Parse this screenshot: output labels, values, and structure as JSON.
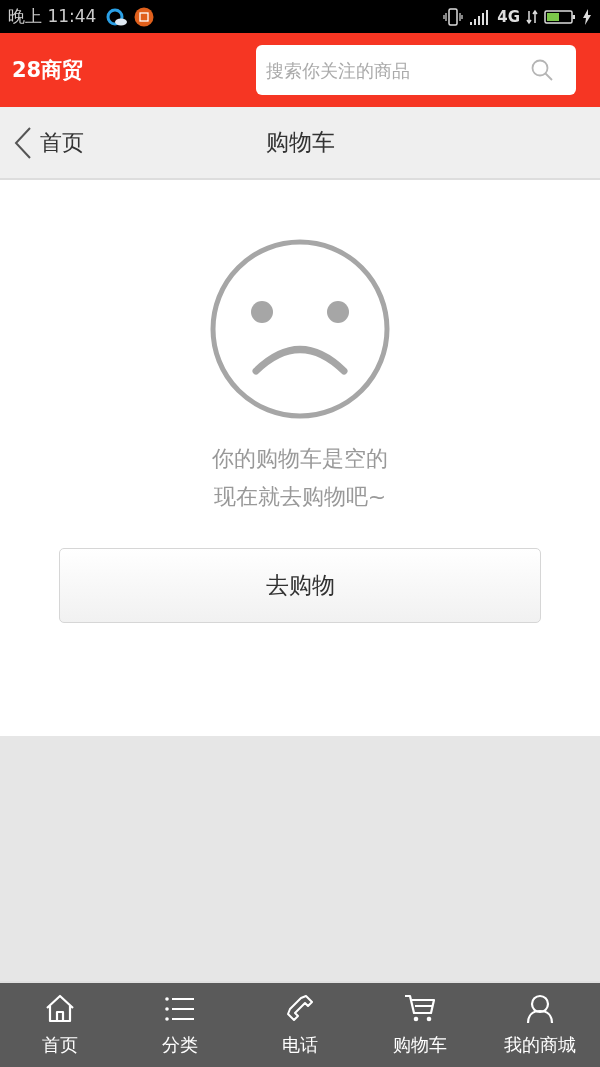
{
  "status_bar": {
    "time": "晚上 11:44",
    "network": "4G"
  },
  "header": {
    "logo": "28商贸",
    "search": {
      "placeholder": "搜索你关注的商品"
    }
  },
  "nav_bar": {
    "back_label": "首页",
    "title": "购物车"
  },
  "empty_cart": {
    "lines": [
      "你的购物车是空的",
      "现在就去购物吧~"
    ],
    "button": "去购物"
  },
  "tab_bar": [
    {
      "kind": "home",
      "label": "首页"
    },
    {
      "kind": "list",
      "label": "分类"
    },
    {
      "kind": "phone",
      "label": "电话"
    },
    {
      "kind": "cart",
      "label": "购物车"
    },
    {
      "kind": "user",
      "label": "我的商城"
    }
  ]
}
